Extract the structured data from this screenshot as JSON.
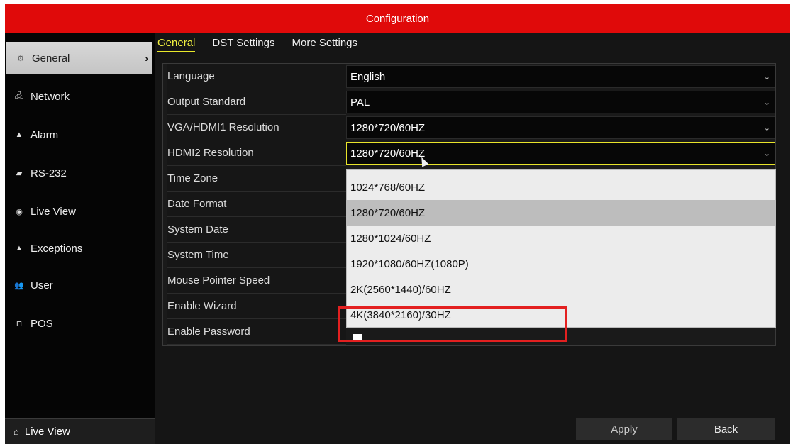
{
  "window": {
    "title": "Configuration"
  },
  "sidebar": {
    "items": [
      {
        "label": "General",
        "icon": "gear-icon",
        "glyph": "⚙",
        "active": true
      },
      {
        "label": "Network",
        "icon": "network-icon",
        "glyph": "🖧"
      },
      {
        "label": "Alarm",
        "icon": "alarm-icon",
        "glyph": "▲"
      },
      {
        "label": "RS-232",
        "icon": "rs232-icon",
        "glyph": "▰"
      },
      {
        "label": "Live View",
        "icon": "eye-icon",
        "glyph": "◉"
      },
      {
        "label": "Exceptions",
        "icon": "warning-icon",
        "glyph": "▲"
      },
      {
        "label": "User",
        "icon": "user-icon",
        "glyph": "👥"
      },
      {
        "label": "POS",
        "icon": "pos-icon",
        "glyph": "⊓"
      }
    ],
    "bottom": {
      "label": "Live View",
      "icon": "home-icon",
      "glyph": "⌂"
    }
  },
  "tabs": [
    {
      "label": "General",
      "active": true
    },
    {
      "label": "DST Settings"
    },
    {
      "label": "More Settings"
    }
  ],
  "form": {
    "rows": [
      {
        "label": "Language",
        "value": "English",
        "dropdown": true
      },
      {
        "label": "Output Standard",
        "value": "PAL",
        "dropdown": true
      },
      {
        "label": "VGA/HDMI1 Resolution",
        "value": "1280*720/60HZ",
        "dropdown": true
      },
      {
        "label": "HDMI2 Resolution",
        "value": "1280*720/60HZ",
        "dropdown": true,
        "focused": true
      },
      {
        "label": "Time Zone"
      },
      {
        "label": "Date Format"
      },
      {
        "label": "System Date"
      },
      {
        "label": "System Time"
      },
      {
        "label": "Mouse Pointer Speed"
      },
      {
        "label": "Enable Wizard"
      },
      {
        "label": "Enable Password"
      }
    ]
  },
  "dropdown": {
    "options": [
      "1024*768/60HZ",
      "1280*720/60HZ",
      "1280*1024/60HZ",
      "1920*1080/60HZ(1080P)",
      "2K(2560*1440)/60HZ",
      "4K(3840*2160)/30HZ"
    ],
    "selected": "1280*720/60HZ",
    "highlighted": "4K(3840*2160)/30HZ"
  },
  "buttons": {
    "apply": "Apply",
    "back": "Back"
  },
  "colors": {
    "title_bar": "#e00a0a",
    "active_tab": "#f1f140",
    "highlight_box": "#e32020"
  }
}
